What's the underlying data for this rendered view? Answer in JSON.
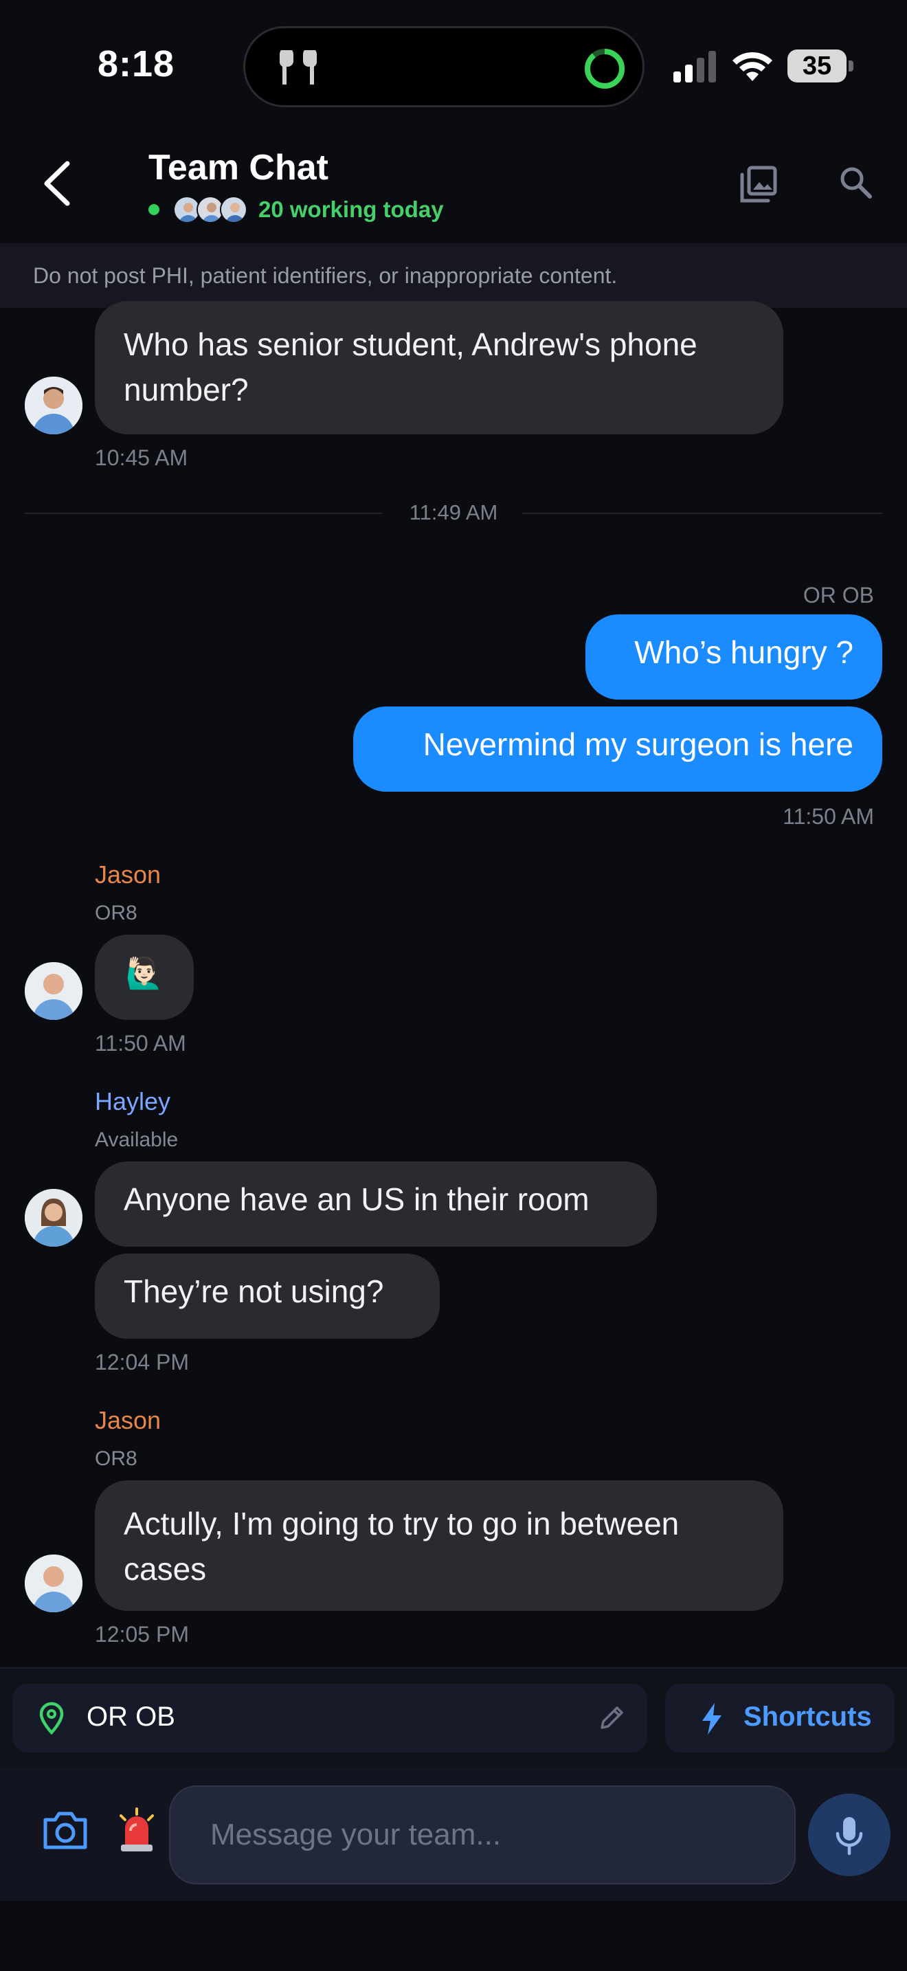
{
  "status_bar": {
    "time": "8:18",
    "battery": "35",
    "icons": [
      "airpods-icon",
      "activity-ring-icon",
      "signal-icon",
      "wifi-icon",
      "battery-icon"
    ]
  },
  "header": {
    "title": "Team Chat",
    "working_label": "20 working today",
    "back_icon": "chevron-left-icon",
    "gallery_icon": "photo-library-icon",
    "search_icon": "search-icon"
  },
  "notice": "Do not post PHI, patient identifiers, or inappropriate content.",
  "messages": {
    "andrew_phone": {
      "text": "Who has senior student, Andrew's phone number?",
      "time": "10:45 AM"
    },
    "divider_time": "11:49 AM",
    "outgoing": {
      "location": "OR OB",
      "msg1": "Who’s hungry ?",
      "msg2": "Nevermind my surgeon is here",
      "time": "11:50 AM"
    },
    "jason_1": {
      "name": "Jason",
      "role": "OR8",
      "emoji": "🙋🏻‍♂️",
      "time": "11:50 AM"
    },
    "hayley": {
      "name": "Hayley",
      "role": "Available",
      "msg1": "Anyone have an US in their room",
      "msg2": "They’re not using?",
      "time": "12:04 PM"
    },
    "jason_2": {
      "name": "Jason",
      "role": "OR8",
      "text": "Actully, I'm going to try to go in between cases",
      "time": "12:05 PM"
    }
  },
  "location_bar": {
    "location": "OR OB",
    "shortcuts_label": "Shortcuts"
  },
  "composer": {
    "placeholder": "Message your team..."
  },
  "colors": {
    "background": "#0b0c12",
    "bubble_incoming": "#2a2b31",
    "bubble_outgoing": "#1a8cff",
    "online_green": "#46d069",
    "jason_name": "#e8864a",
    "hayley_name": "#7ea5ff",
    "accent_blue": "#4d9bff"
  }
}
